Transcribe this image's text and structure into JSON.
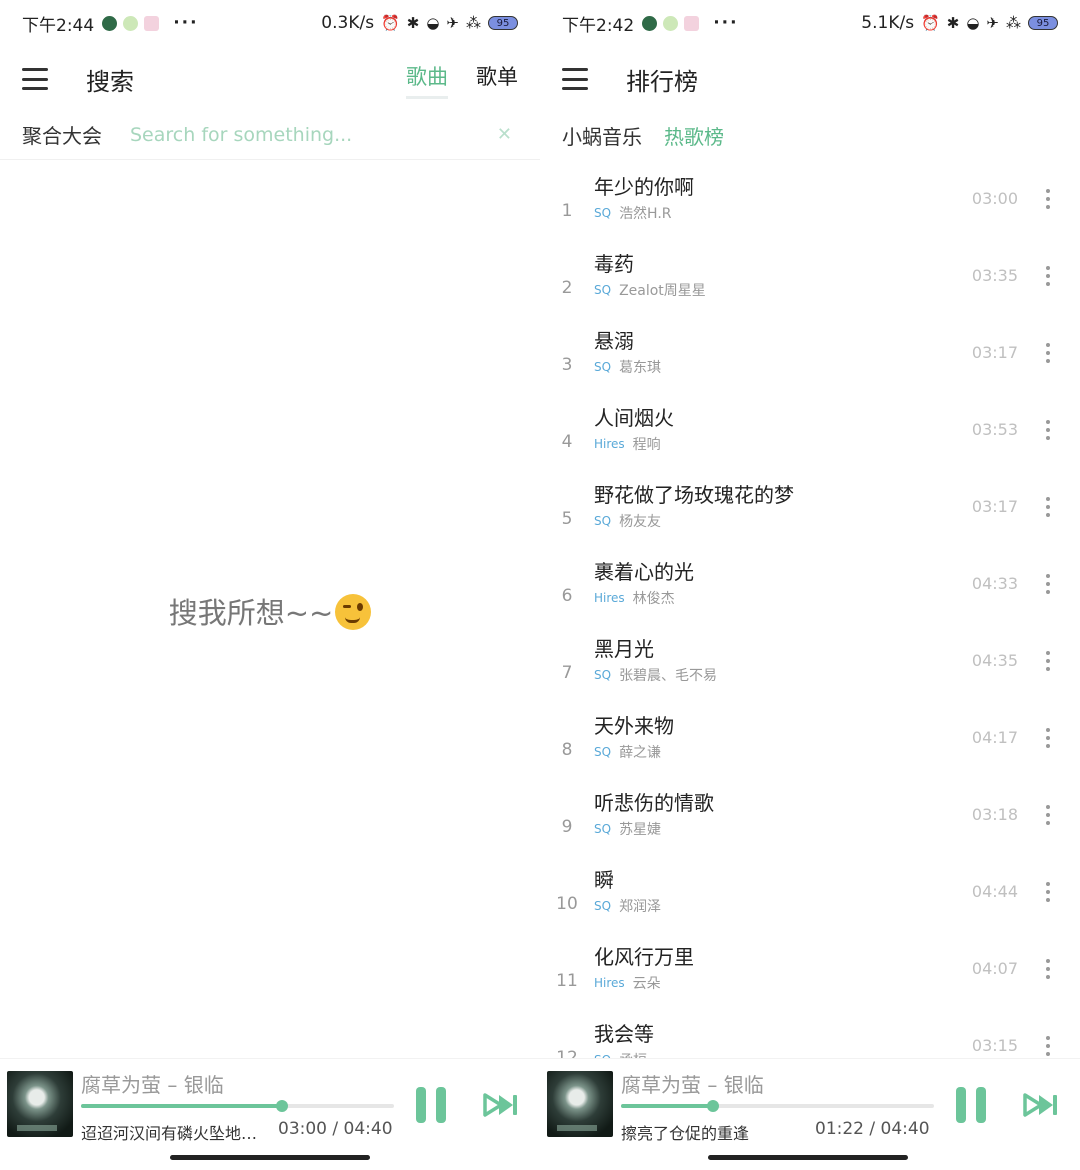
{
  "left": {
    "status": {
      "time": "下午2:44",
      "net": "0.3K/s",
      "battery": "95"
    },
    "title": "搜索",
    "tabs": [
      "歌曲",
      "歌单"
    ],
    "source_label": "聚合大会",
    "search_placeholder": "Search for something...",
    "empty_hint": "搜我所想~~",
    "player": {
      "title": "腐草为萤 – 银临",
      "lyric": "迢迢河汉间有磷火坠地…",
      "time": "03:00 / 04:40",
      "progress": 0.643
    }
  },
  "right": {
    "status": {
      "time": "下午2:42",
      "net": "5.1K/s",
      "battery": "95"
    },
    "title": "排行榜",
    "tabs": [
      "小蜗音乐",
      "热歌榜"
    ],
    "songs": [
      {
        "num": "1",
        "title": "年少的你啊",
        "quality": "SQ",
        "artist": "浩然H.R",
        "duration": "03:00"
      },
      {
        "num": "2",
        "title": "毒药",
        "quality": "SQ",
        "artist": "Zealot周星星",
        "duration": "03:35"
      },
      {
        "num": "3",
        "title": "悬溺",
        "quality": "SQ",
        "artist": "葛东琪",
        "duration": "03:17"
      },
      {
        "num": "4",
        "title": "人间烟火",
        "quality": "Hires",
        "artist": "程响",
        "duration": "03:53"
      },
      {
        "num": "5",
        "title": "野花做了场玫瑰花的梦",
        "quality": "SQ",
        "artist": "杨友友",
        "duration": "03:17"
      },
      {
        "num": "6",
        "title": "裹着心的光",
        "quality": "Hires",
        "artist": "林俊杰",
        "duration": "04:33"
      },
      {
        "num": "7",
        "title": "黑月光",
        "quality": "SQ",
        "artist": "张碧晨、毛不易",
        "duration": "04:35"
      },
      {
        "num": "8",
        "title": "天外来物",
        "quality": "SQ",
        "artist": "薛之谦",
        "duration": "04:17"
      },
      {
        "num": "9",
        "title": "听悲伤的情歌",
        "quality": "SQ",
        "artist": "苏星婕",
        "duration": "03:18"
      },
      {
        "num": "10",
        "title": "瞬",
        "quality": "SQ",
        "artist": "郑润泽",
        "duration": "04:44"
      },
      {
        "num": "11",
        "title": "化风行万里",
        "quality": "Hires",
        "artist": "云朵",
        "duration": "04:07"
      },
      {
        "num": "12",
        "title": "我会等",
        "quality": "SQ",
        "artist": "承桓",
        "duration": "03:15"
      }
    ],
    "player": {
      "title": "腐草为萤 – 银临",
      "lyric": "擦亮了仓促的重逢",
      "time": "01:22 / 04:40",
      "progress": 0.293
    }
  },
  "colors": {
    "accent": "#5cb98a",
    "quality": "#5aa9d8"
  },
  "icons": [
    "menu-icon",
    "close-icon",
    "more-vert-icon",
    "pause-icon",
    "skip-next-icon"
  ]
}
